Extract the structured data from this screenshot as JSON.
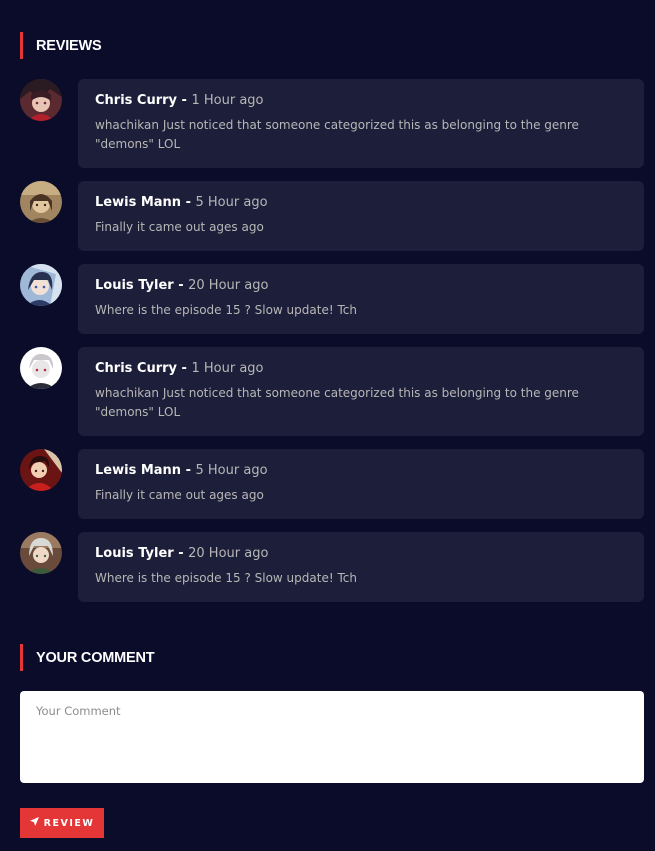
{
  "reviews_section": {
    "title": "REVIEWS",
    "items": [
      {
        "name": "Chris Curry - ",
        "time": "1 Hour ago",
        "text": "whachikan Just noticed that someone categorized this as belonging to the genre \"demons\" LOL",
        "avatar": "avatar-anime-girl-red"
      },
      {
        "name": "Lewis Mann - ",
        "time": "5 Hour ago",
        "text": "Finally it came out ages ago",
        "avatar": "avatar-anime-brown"
      },
      {
        "name": "Louis Tyler - ",
        "time": "20 Hour ago",
        "text": "Where is the episode 15 ? Slow update! Tch",
        "avatar": "avatar-anime-blue"
      },
      {
        "name": "Chris Curry - ",
        "time": "1 Hour ago",
        "text": "whachikan Just noticed that someone categorized this as belonging to the genre \"demons\" LOL",
        "avatar": "avatar-anime-white"
      },
      {
        "name": "Lewis Mann - ",
        "time": "5 Hour ago",
        "text": "Finally it came out ages ago",
        "avatar": "avatar-anime-red"
      },
      {
        "name": "Louis Tyler - ",
        "time": "20 Hour ago",
        "text": "Where is the episode 15 ? Slow update! Tch",
        "avatar": "avatar-anime-green"
      }
    ]
  },
  "comment_section": {
    "title": "YOUR COMMENT",
    "placeholder": "Your Comment",
    "button_label": "REVIEW",
    "button_icon": "send-icon"
  },
  "colors": {
    "background": "#0b0c2a",
    "card": "#1d1e39",
    "accent": "#e53637"
  }
}
